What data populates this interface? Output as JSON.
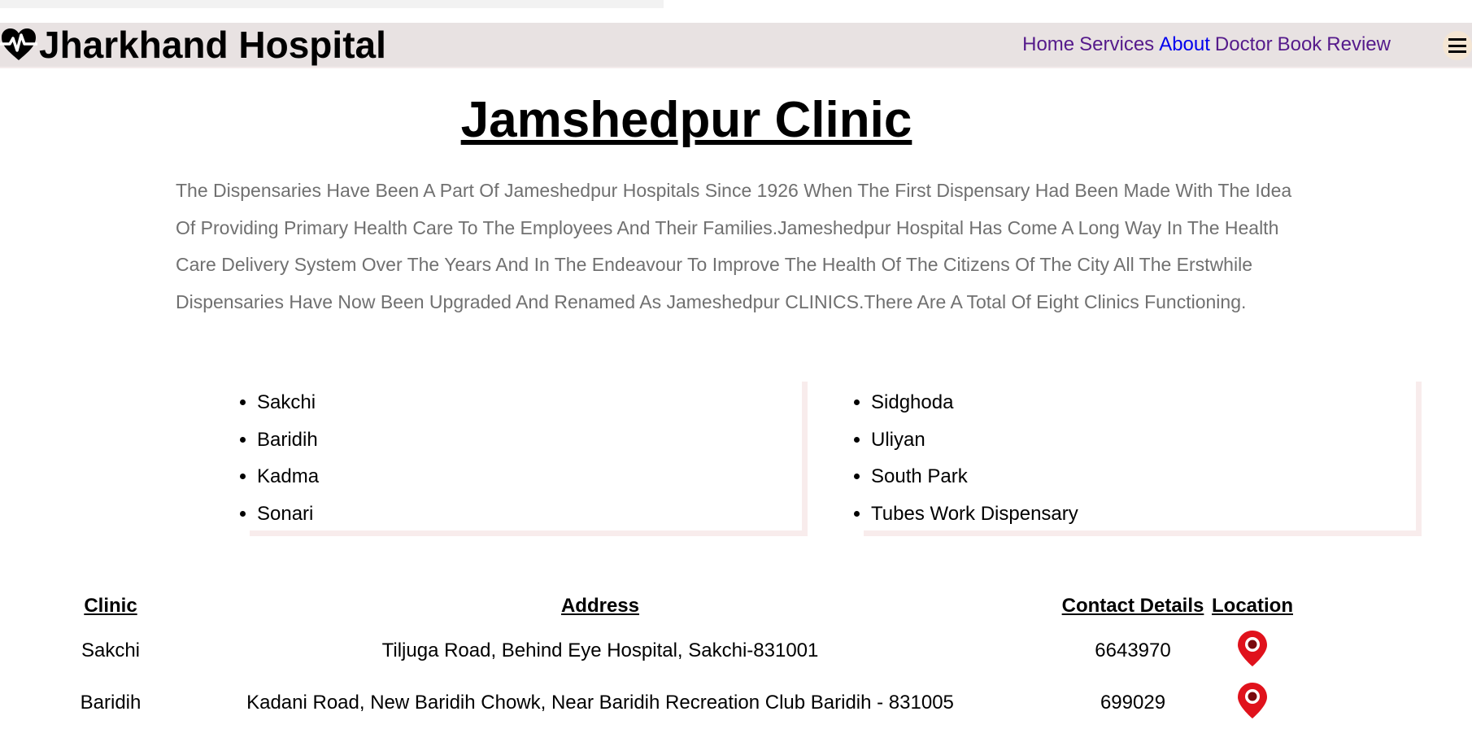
{
  "header": {
    "brand": "Jharkhand Hospital",
    "brand_icon": "heartbeat-icon",
    "nav": [
      {
        "label": "Home"
      },
      {
        "label": "Services"
      },
      {
        "label": "About"
      },
      {
        "label": "Doctor"
      },
      {
        "label": "Book"
      },
      {
        "label": "Review"
      }
    ],
    "menu_icon": "hamburger-menu-icon"
  },
  "main": {
    "title": "Jamshedpur Clinic",
    "intro": "The Dispensaries Have Been A Part Of Jameshedpur Hospitals Since 1926 When The First Dispensary Had Been Made With The Idea Of Providing Primary Health Care To The Employees And Their Families.Jameshedpur Hospital Has Come A Long Way In The Health Care Delivery System Over The Years And In The Endeavour To Improve The Health Of The Citizens Of The City All The Erstwhile Dispensaries Have Now Been Upgraded And Renamed As Jameshedpur CLINICS.There Are A Total Of Eight Clinics Functioning.",
    "clinics_left": [
      "Sakchi",
      "Baridih",
      "Kadma",
      "Sonari"
    ],
    "clinics_right": [
      "Sidghoda",
      "Uliyan",
      "South Park",
      "Tubes Work Dispensary"
    ]
  },
  "table": {
    "headers": [
      "Clinic",
      "Address",
      "Contact Details",
      "Location"
    ],
    "rows": [
      {
        "clinic": "Sakchi",
        "address": "Tiljuga Road, Behind Eye Hospital, Sakchi-831001",
        "contact": "6643970",
        "location_icon": "map-pin-icon"
      },
      {
        "clinic": "Baridih",
        "address": "Kadani Road, New Baridih Chowk, Near Baridih Recreation Club Baridih - 831005",
        "contact": "699029",
        "location_icon": "map-pin-icon"
      }
    ]
  },
  "colors": {
    "navbar_bg": "#e8e2e2",
    "link_visited": "#551a8b",
    "link_active": "#0000ee",
    "intro_text": "#707070",
    "pin_red": "#e0121c"
  }
}
